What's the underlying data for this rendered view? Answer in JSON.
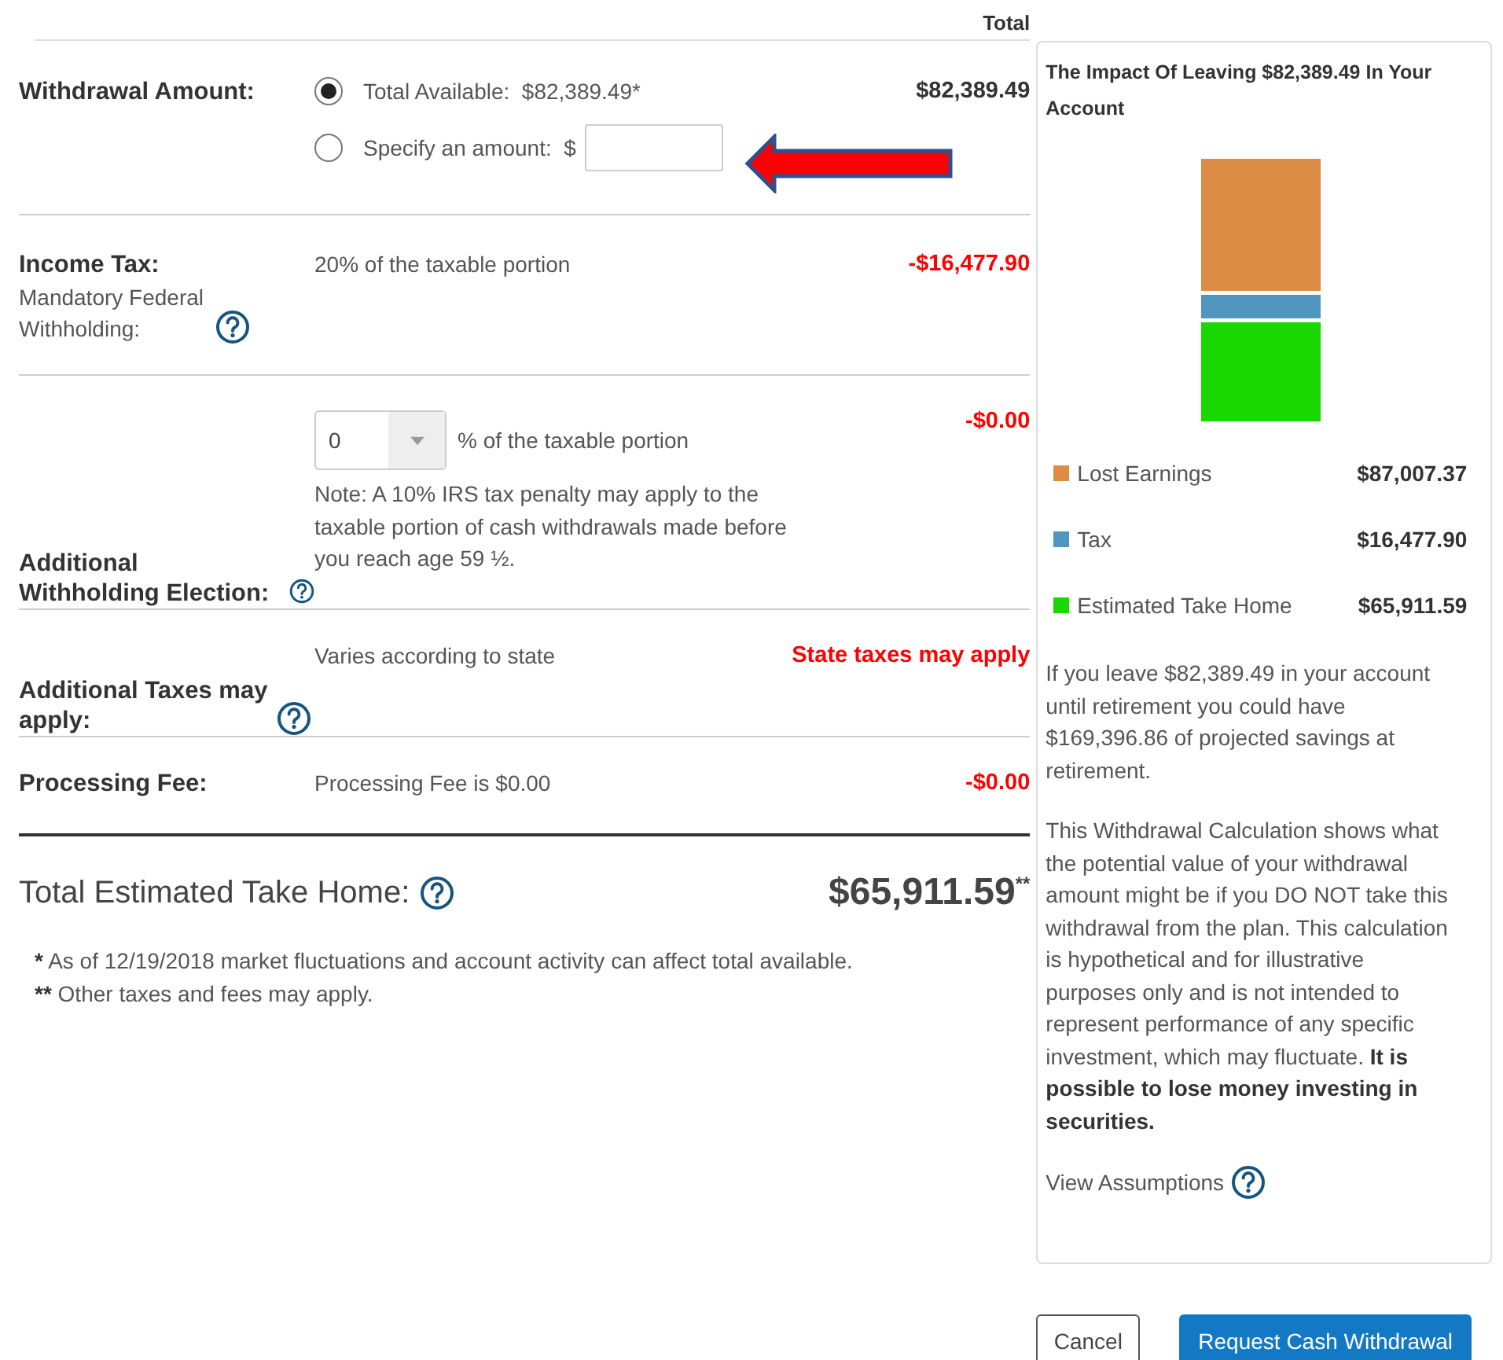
{
  "header": {
    "total_label": "Total"
  },
  "rows": [
    {
      "kind": "withdrawal",
      "label": "Withdrawal Amount:",
      "options": [
        {
          "label": "Total Available:  $82,389.49*",
          "selected": true,
          "kind": "plain"
        },
        {
          "label": "Specify an amount:  $",
          "selected": false,
          "kind": "input"
        }
      ],
      "amount": "$82,389.49",
      "highlight": false,
      "pointer_arrow": true
    },
    {
      "kind": "text",
      "label": "Income Tax:",
      "sublabel": "Mandatory Federal Withholding:",
      "help": true,
      "description": "20% of the taxable portion",
      "amount": "-$16,477.90",
      "highlight": true
    },
    {
      "kind": "select",
      "label": "Additional Withholding Election:",
      "help": true,
      "select_value": "0",
      "description": "% of the taxable portion",
      "note": "Note: A 10% IRS tax penalty may apply to the taxable portion of cash withdrawals made before you reach age 59 ½.",
      "amount": "-$0.00",
      "highlight": true
    },
    {
      "kind": "text",
      "label": "Additional Taxes may apply:",
      "help": true,
      "description": "Varies according to state",
      "amount": "State taxes may apply",
      "highlight": true
    },
    {
      "kind": "text",
      "label": "Processing Fee:",
      "description": "Processing Fee is $0.00",
      "amount": "-$0.00",
      "highlight": true
    }
  ],
  "total": {
    "label": "Total Estimated Take Home:",
    "help": true,
    "amount": "$65,911.59$^{**}$"
  },
  "footnotes": [
    {
      "mark": "*",
      "text": "As of 12/19/2018 market fluctuations and account activity can affect total available."
    },
    {
      "mark": "**",
      "text": "Other taxes and fees may apply."
    }
  ],
  "panel": {
    "title": "The Impact Of Leaving $82,389.49 In Your Account",
    "legend": [
      {
        "label": "Lost Earnings",
        "amount": "$87,007.37",
        "color": "#dc8c44"
      },
      {
        "label": "Tax",
        "amount": "$16,477.90",
        "color": "#5096be"
      },
      {
        "label": "Estimated Take Home",
        "amount": "$65,911.59",
        "color": "#18d800"
      }
    ],
    "paragraphs": [
      "If you leave $82,389.49 in your account until retirement you could have $169,396.86 of projected savings at retirement.",
      "This Withdrawal Calculation shows what the potential value of your withdrawal amount might be if you DO NOT take this withdrawal from the plan. This calculation is hypothetical and for illustrative purposes only and is not intended to represent performance of any specific investment, which may fluctuate. **It is possible to lose money investing in securities.**"
    ],
    "link": {
      "label": "View Assumptions",
      "help": true
    }
  },
  "buttons": [
    {
      "label": "Cancel",
      "kind": "secondary"
    },
    {
      "label": "Request Cash Withdrawal",
      "kind": "primary"
    }
  ]
}
